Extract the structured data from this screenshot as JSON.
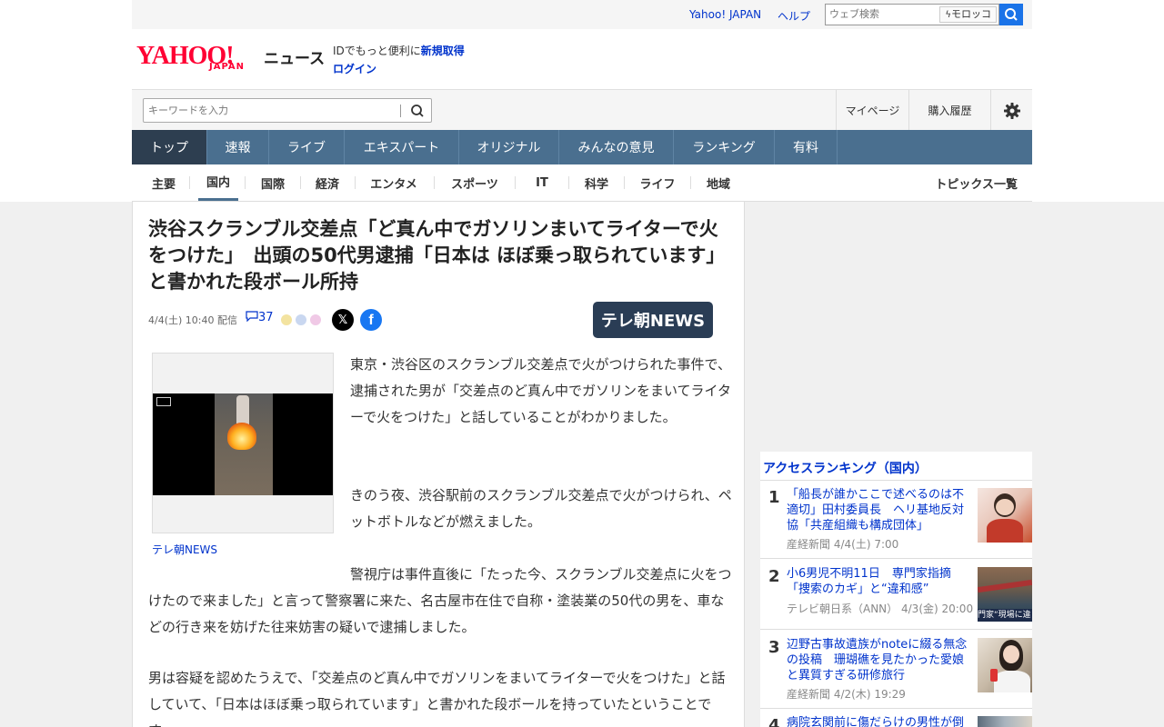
{
  "topbar": {
    "links": [
      "Yahoo! JAPAN",
      "ヘルプ"
    ],
    "web_search_placeholder": "ウェブ検索",
    "search_brand": "モロッコ"
  },
  "header": {
    "logo_main": "YAHOO!",
    "logo_sub": "JAPAN",
    "logo_news": "ニュース",
    "id_text": "IDでもっと便利に",
    "id_link": "新規取得",
    "login": "ログイン"
  },
  "search": {
    "placeholder": "キーワードを入力",
    "tools": [
      "マイページ",
      "購入履歴"
    ]
  },
  "nav": [
    "トップ",
    "速報",
    "ライブ",
    "エキスパート",
    "オリジナル",
    "みんなの意見",
    "ランキング",
    "有料"
  ],
  "subnav": [
    "主要",
    "国内",
    "国際",
    "経済",
    "エンタメ",
    "スポーツ",
    "IT",
    "科学",
    "ライフ",
    "地域"
  ],
  "topics_link": "トピックス一覧",
  "article": {
    "headline": "渋谷スクランブル交差点「ど真ん中でガソリンまいてライターで火をつけた」　出頭の50代男逮捕「日本は ほぼ乗っ取られています」と書かれた段ボール所持",
    "date": "4/4(土) 10:40 配信",
    "comment_count": "37",
    "source": "テレ朝NEWS",
    "image_caption": "テレ朝NEWS",
    "paragraphs": [
      "東京・渋谷区のスクランブル交差点で火がつけられた事件で、逮捕された男が「交差点のど真ん中でガソリンをまいてライターで火をつけた」と話していることがわかりました。",
      "きのう夜、渋谷駅前のスクランブル交差点で火がつけられ、ペットボトルなどが燃えました。",
      "警視庁は事件直後に「たった今、スクランブル交差点に火をつけたので来ました」と言って警察署に来た、名古屋市在住で自称・塗装業の50代の男を、車などの行き来を妨げた往来妨害の疑いで逮捕しました。",
      "男は容疑を認めたうえで、「交差点のど真ん中でガソリンをまいてライターで火をつけた」と話していて、「日本はほぼ乗っ取られています」と書かれた段ボールを持っていたということです。"
    ]
  },
  "ranking": {
    "title": "アクセスランキング（国内）",
    "items": [
      {
        "rank": "1",
        "title": "「船長が誰かここで述べるのは不適切」田村委員長　ヘリ基地反対協「共産組織も構成団体」",
        "source": "産経新聞",
        "date": "4/4(土) 7:00"
      },
      {
        "rank": "2",
        "title": "小6男児不明11日　専門家指摘「捜索のカギ」と“違和感”",
        "source": "テレビ朝日系（ANN）",
        "date": "4/3(金) 20:00",
        "thumb_text": "門家“現場に違"
      },
      {
        "rank": "3",
        "title": "辺野古事故遺族がnoteに綴る無念の投稿　珊瑚礁を見たかった愛娘と異質すぎる研修旅行",
        "source": "産経新聞",
        "date": "4/2(木) 19:29"
      },
      {
        "rank": "4",
        "title": "病院玄関前に傷だらけの男性が倒",
        "source": "",
        "date": ""
      }
    ]
  },
  "colors": {
    "nav_bg": "#4a6f8f",
    "nav_active": "#2d3e50",
    "link": "#0033cc",
    "brand_red": "#ff0033"
  }
}
